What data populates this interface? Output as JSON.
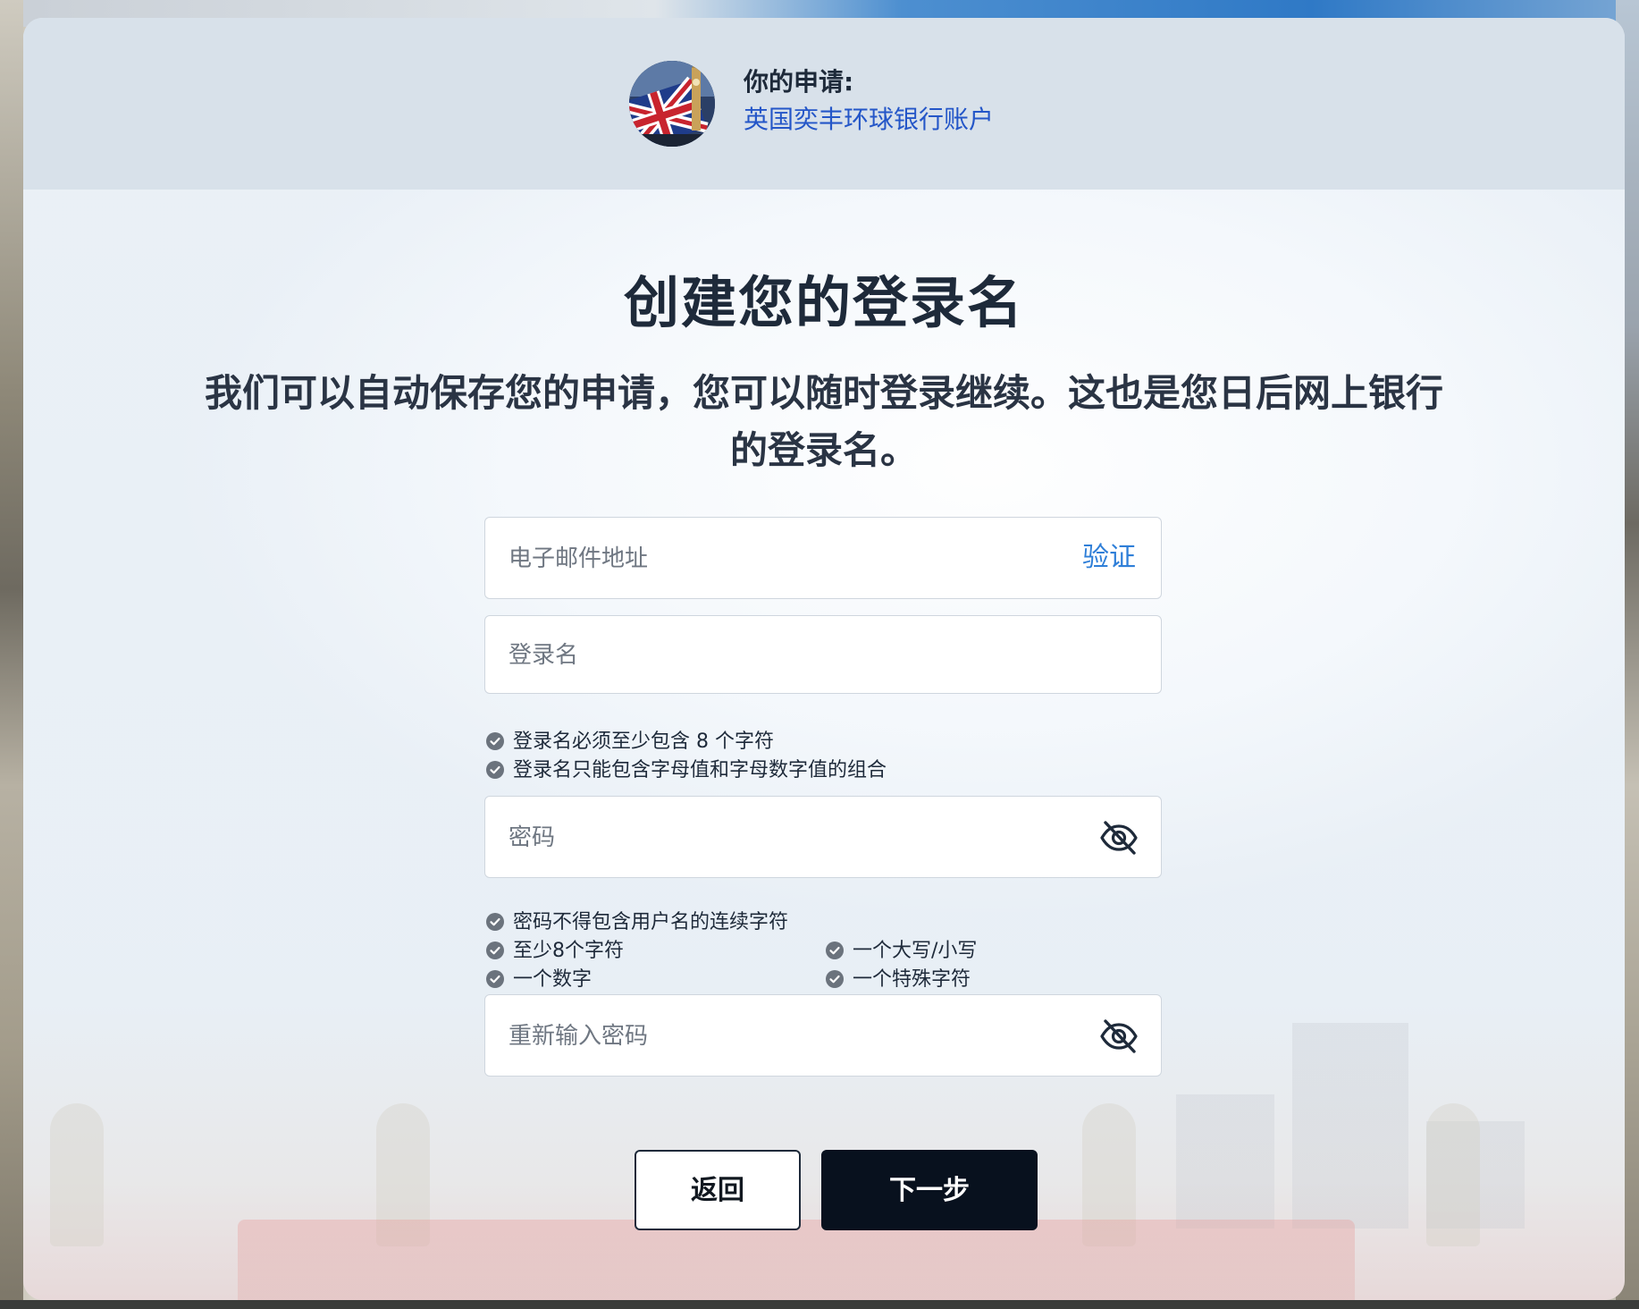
{
  "header": {
    "label": "你的申请:",
    "product": "英国奕丰环球银行账户"
  },
  "main": {
    "title": "创建您的登录名",
    "subtitle": "我们可以自动保存您的申请，您可以随时登录继续。这也是您日后网上银行的登录名。"
  },
  "form": {
    "email": {
      "placeholder": "电子邮件地址",
      "value": "",
      "verify_label": "验证"
    },
    "login": {
      "placeholder": "登录名",
      "value": "",
      "rules": [
        "登录名必须至少包含 8 个字符",
        "登录名只能包含字母值和字母数字值的组合"
      ]
    },
    "password": {
      "placeholder": "密码",
      "value": "",
      "rules": [
        "密码不得包含用户名的连续字符",
        "至少8个字符",
        "一个大写/小写",
        "一个数字",
        "一个特殊字符"
      ]
    },
    "repassword": {
      "placeholder": "重新输入密码",
      "value": ""
    }
  },
  "buttons": {
    "back_label": "返回",
    "next_label": "下一步"
  },
  "icons": {
    "avatar": "uk-flag-big-ben-image",
    "eye": "eye-off-icon",
    "check": "check-circle-icon"
  },
  "colors": {
    "header_bg": "#d8e1ea",
    "link_blue": "#2456c8",
    "verify_blue": "#2f7fd8",
    "primary_button": "#08111e"
  }
}
